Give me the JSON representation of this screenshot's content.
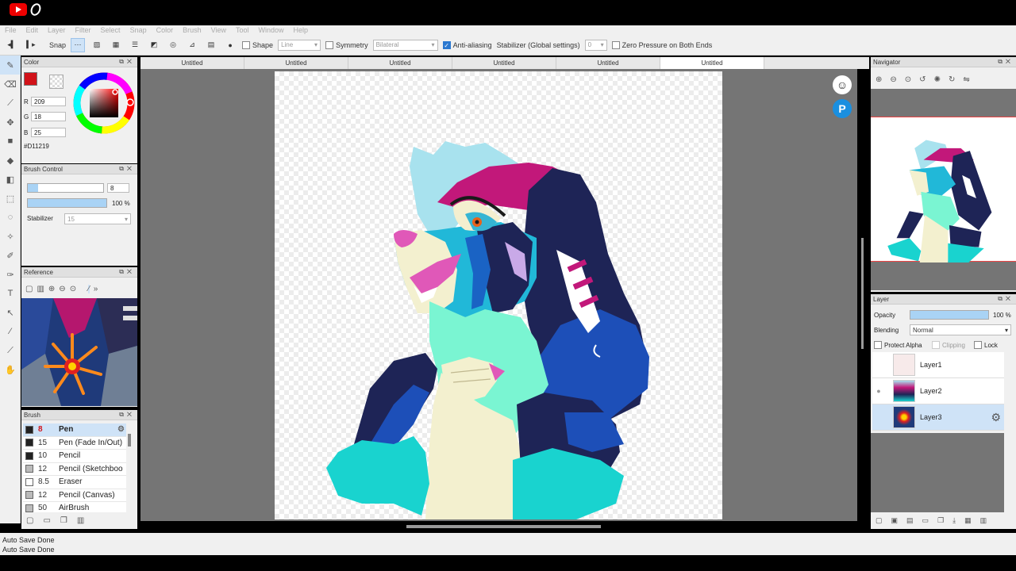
{
  "menu": [
    "File",
    "Edit",
    "Layer",
    "Filter",
    "Select",
    "Snap",
    "Color",
    "Brush",
    "View",
    "Tool",
    "Window",
    "Help"
  ],
  "toolbar": {
    "snap_label": "Snap",
    "shape_label": "Shape",
    "shape_value": "Line",
    "symmetry_label": "Symmetry",
    "symmetry_value": "Bilateral",
    "antialias_label": "Anti-aliasing",
    "stabilizer_label": "Stabilizer (Global settings)",
    "stabilizer_value": "0",
    "zero_pressure_label": "Zero Pressure on Both Ends"
  },
  "color_panel": {
    "title": "Color",
    "r_label": "R",
    "r_value": "209",
    "g_label": "G",
    "g_value": "18",
    "b_label": "B",
    "b_value": "25",
    "hex": "#D11219",
    "fg_color": "#D11219"
  },
  "brush_control": {
    "title": "Brush Control",
    "size": "8",
    "opacity": "100 %",
    "stabilizer_label": "Stabilizer",
    "stabilizer_value": "15"
  },
  "reference": {
    "title": "Reference"
  },
  "brush_panel": {
    "title": "Brush",
    "items": [
      {
        "size": "8",
        "name": "Pen",
        "swatch": "#222222"
      },
      {
        "size": "15",
        "name": "Pen (Fade In/Out)",
        "swatch": "#222222"
      },
      {
        "size": "10",
        "name": "Pencil",
        "swatch": "#222222"
      },
      {
        "size": "12",
        "name": "Pencil (Sketchboo",
        "swatch": "#bbbbbb"
      },
      {
        "size": "8.5",
        "name": "Eraser",
        "swatch": "#ffffff"
      },
      {
        "size": "12",
        "name": "Pencil (Canvas)",
        "swatch": "#bbbbbb"
      },
      {
        "size": "50",
        "name": "AirBrush",
        "swatch": "#bbbbbb"
      }
    ]
  },
  "tabs": [
    "Untitled",
    "Untitled",
    "Untitled",
    "Untitled",
    "Untitled",
    "Untitled"
  ],
  "navigator": {
    "title": "Navigator"
  },
  "layer_panel": {
    "title": "Layer",
    "opacity_label": "Opacity",
    "opacity_value": "100 %",
    "opacity_fraction": 1.0,
    "blending_label": "Blending",
    "blending_value": "Normal",
    "protect_alpha": "Protect Alpha",
    "clipping": "Clipping",
    "lock": "Lock",
    "layers": [
      {
        "name": "Layer1"
      },
      {
        "name": "Layer2"
      },
      {
        "name": "Layer3"
      }
    ]
  },
  "status": {
    "line1": "Auto Save Done",
    "line2": "Auto Save Done"
  },
  "colors": {
    "accent": "#2b78d0",
    "selection": "#cfe3f7",
    "canvas_bg": "#757575"
  }
}
